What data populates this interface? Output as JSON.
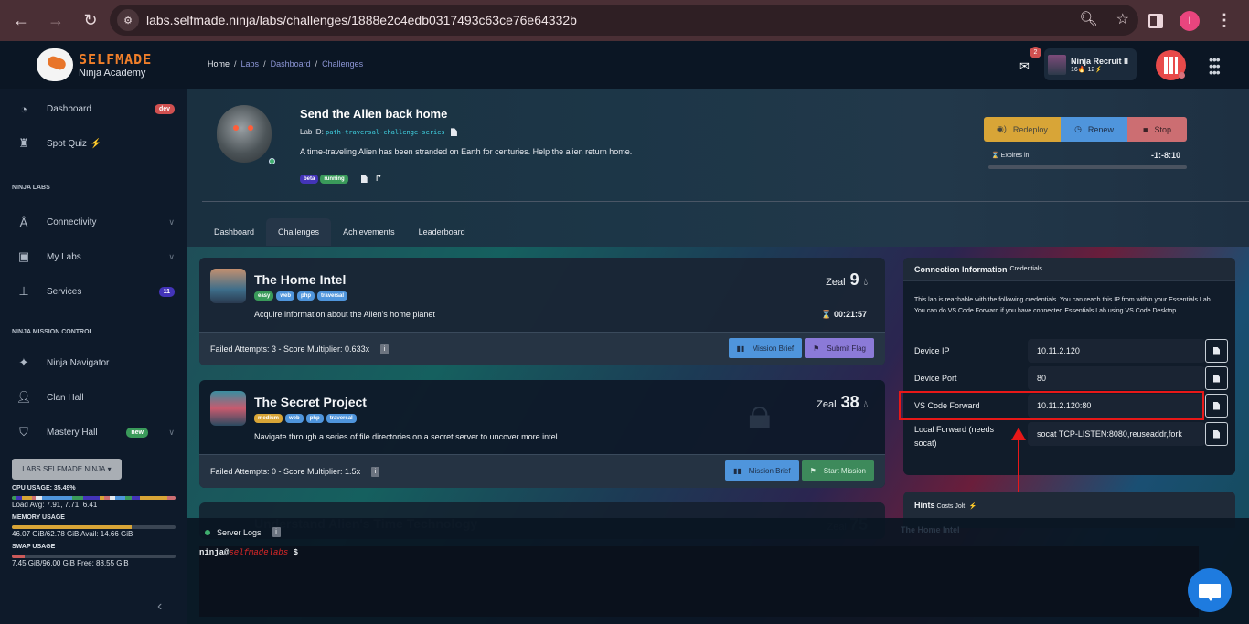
{
  "browser": {
    "url": "labs.selfmade.ninja/labs/challenges/1888e2c4edb0317493c63ce76e64332b",
    "profile_initial": "I"
  },
  "sidebar": {
    "logo_title": "SELFMADE",
    "logo_subtitle": "Ninja Academy",
    "items_top": [
      {
        "label": "Dashboard",
        "icon": "speedometer-icon",
        "badge": "dev",
        "badge_color": "#d05050"
      },
      {
        "label": "Spot Quiz",
        "icon": "weightlifter-icon",
        "suffix": "⚡"
      }
    ],
    "section_labs": "NINJA LABS",
    "items_labs": [
      {
        "label": "Connectivity",
        "icon": "antenna-icon"
      },
      {
        "label": "My Labs",
        "icon": "window-icon"
      },
      {
        "label": "Services",
        "icon": "network-icon",
        "badge": "11",
        "badge_color": "#4334b8"
      }
    ],
    "section_mission": "NINJA MISSION CONTROL",
    "items_mission": [
      {
        "label": "Ninja Navigator",
        "icon": "compass-icon"
      },
      {
        "label": "Clan Hall",
        "icon": "users-icon"
      },
      {
        "label": "Mastery Hall",
        "icon": "shield-icon",
        "badge": "new",
        "badge_color": "#3a9a5a"
      }
    ],
    "env_button": "LABS.SELFMADE.NINJA",
    "cpu_title": "CPU USAGE: 35.49%",
    "cpu_percent": 35.49,
    "load_avg": "Load Avg: 7.91, 7.71, 6.41",
    "memory_title": "MEMORY USAGE",
    "memory_text": "46.07 GiB/62.78 GiB Avail: 14.66 GiB",
    "memory_fraction": 0.734,
    "swap_title": "SWAP USAGE",
    "swap_text": "7.45 GiB/96.00 GiB Free: 88.55 GiB",
    "swap_fraction": 0.078
  },
  "header": {
    "breadcrumb": [
      "Home",
      "Labs",
      "Dashboard",
      "Challenges"
    ],
    "mail_count": "2",
    "rank_name": "Ninja Recruit II",
    "rank_stats": "16🔥 12⚡"
  },
  "lab": {
    "title": "Send the Alien back home",
    "id_label": "Lab ID:",
    "id": "path-traversal-challenge-series",
    "description": "A time-traveling Alien has been stranded on Earth for centuries. Help the alien return home.",
    "tags": [
      {
        "label": "beta",
        "color": "#4334b8"
      },
      {
        "label": "running",
        "color": "#3a9a5a"
      }
    ],
    "actions": {
      "redeploy": "Redeploy",
      "renew": "Renew",
      "stop": "Stop"
    },
    "expires_label": "Expires in",
    "expires_value": "-1:-8:10"
  },
  "tabs": [
    "Dashboard",
    "Challenges",
    "Achievements",
    "Leaderboard"
  ],
  "active_tab": "Challenges",
  "challenges": [
    {
      "title": "The Home Intel",
      "tags": [
        {
          "label": "easy",
          "color": "#3a9a5a"
        },
        {
          "label": "web",
          "color": "#4f95dc"
        },
        {
          "label": "php",
          "color": "#4f95dc"
        },
        {
          "label": "traversal",
          "color": "#4f95dc"
        }
      ],
      "description": "Acquire information about the Alien's home planet",
      "zeal_label": "Zeal",
      "zeal": "9",
      "timer": "00:21:57",
      "failed": "Failed Attempts: 3 - Score Multiplier: 0.633x",
      "btn_brief": "Mission Brief",
      "btn_action": "Submit Flag"
    },
    {
      "title": "The Secret Project",
      "tags": [
        {
          "label": "medium",
          "color": "#d8a537"
        },
        {
          "label": "web",
          "color": "#4f95dc"
        },
        {
          "label": "php",
          "color": "#4f95dc"
        },
        {
          "label": "traversal",
          "color": "#4f95dc"
        }
      ],
      "description": "Navigate through a series of file directories on a secret server to uncover more intel",
      "zeal_label": "Zeal",
      "zeal": "38",
      "failed": "Failed Attempts: 0 - Score Multiplier: 1.5x",
      "btn_brief": "Mission Brief",
      "btn_action": "Start Mission"
    },
    {
      "title": "Understand Alien's Time Technology",
      "zeal_label": "Zeal",
      "zeal": "75"
    }
  ],
  "connection": {
    "title": "Connection Information",
    "subtitle": "Credentials",
    "description": "This lab is reachable with the following credentials. You can reach this IP from within your Essentials Lab. You can do VS Code Forward if you have connected Essentials Lab using VS Code Desktop.",
    "rows": [
      {
        "label": "Device IP",
        "value": "10.11.2.120"
      },
      {
        "label": "Device Port",
        "value": "80"
      },
      {
        "label": "VS Code Forward",
        "value": "10.11.2.120:80"
      },
      {
        "label": "Local Forward (needs socat)",
        "value": "socat TCP-LISTEN:8080,reuseaddr,fork"
      }
    ]
  },
  "hints": {
    "title": "Hints",
    "subtitle": "Costs Jolt",
    "items": [
      "The Home Intel"
    ]
  },
  "logs": {
    "title": "Server Logs",
    "prompt_user": "ninja@",
    "prompt_host": "selfmadelabs",
    "prompt_symbol": " $"
  }
}
